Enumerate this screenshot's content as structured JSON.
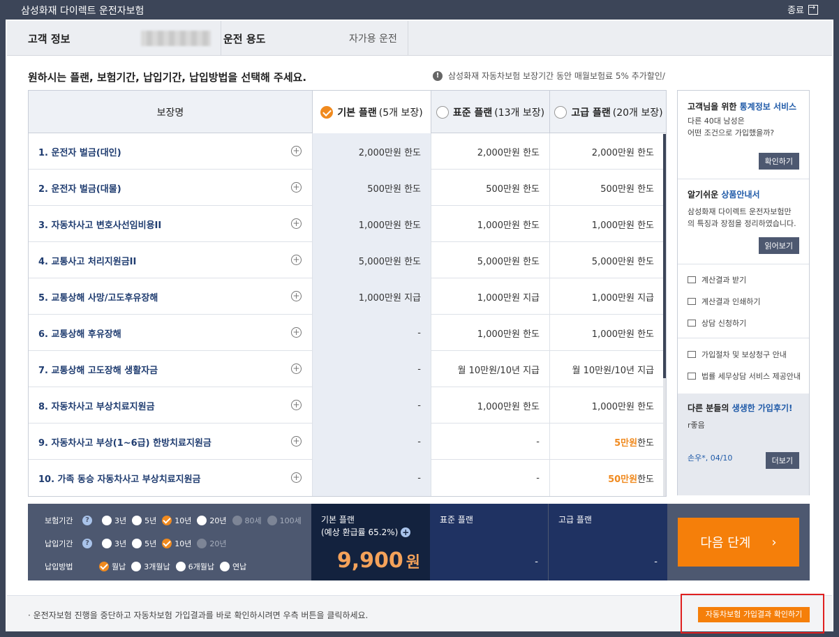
{
  "window": {
    "title": "삼성화재 다이렉트 운전자보험",
    "exit_label": "종료"
  },
  "info": {
    "customer_label": "고객 정보",
    "usage_label": "운전 용도",
    "usage_value": "자가용 운전"
  },
  "instruction": "원하시는 플랜, 보험기간, 납입기간, 납입방법을 선택해 주세요.",
  "notice": "삼성화재 자동차보험 보장기간 동안 매월보험료 5% 추가할인/",
  "table": {
    "col_name": "보장명",
    "plans": [
      {
        "name": "기본 플랜",
        "count": "(5개 보장)",
        "selected": true
      },
      {
        "name": "표준 플랜",
        "count": "(13개 보장)",
        "selected": false
      },
      {
        "name": "고급 플랜",
        "count": "(20개 보장)",
        "selected": false
      }
    ],
    "rows": [
      {
        "name": "1. 운전자 벌금(대인)",
        "basic": "2,000만원 한도",
        "std": "2,000만원 한도",
        "adv": "2,000만원 한도"
      },
      {
        "name": "2. 운전자 벌금(대물)",
        "basic": "500만원 한도",
        "std": "500만원 한도",
        "adv": "500만원 한도"
      },
      {
        "name": "3. 자동차사고 변호사선임비용II",
        "basic": "1,000만원 한도",
        "std": "1,000만원 한도",
        "adv": "1,000만원 한도"
      },
      {
        "name": "4. 교통사고 처리지원금II",
        "basic": "5,000만원 한도",
        "std": "5,000만원 한도",
        "adv": "5,000만원 한도"
      },
      {
        "name": "5. 교통상해 사망/고도후유장해",
        "basic": "1,000만원 지급",
        "std": "1,000만원 지급",
        "adv": "1,000만원 지급"
      },
      {
        "name": "6. 교통상해 후유장해",
        "basic": "-",
        "std": "1,000만원 한도",
        "adv": "1,000만원 한도"
      },
      {
        "name": "7. 교통상해 고도장해 생활자금",
        "basic": "-",
        "std": "월 10만원/10년 지급",
        "adv": "월 10만원/10년 지급"
      },
      {
        "name": "8. 자동차사고 부상치료지원금",
        "basic": "-",
        "std": "1,000만원 한도",
        "adv": "1,000만원 한도"
      },
      {
        "name": "9. 자동차사고 부상(1~6급) 한방치료지원금",
        "basic": "-",
        "std": "-",
        "adv_hl": "5만원",
        "adv_rest": " 한도"
      },
      {
        "name": "10. 가족 동승 자동차사고 부상치료지원금",
        "basic": "-",
        "std": "-",
        "adv_hl": "50만원",
        "adv_rest": " 한도"
      }
    ]
  },
  "side": {
    "stats": {
      "head_a": "고객님을 위한 ",
      "head_b": "통계정보 서비스",
      "text1": "다른 40대 남성은",
      "text2": "어떤 조건으로 가입했을까?",
      "btn": "확인하기"
    },
    "product": {
      "head_a": "알기쉬운 ",
      "head_b": "상품안내서",
      "text1": "삼성화재 다이렉트 운전자보험만",
      "text2": "의 특징과 장점을 정리하였습니다.",
      "btn": "읽어보기"
    },
    "links": [
      "계산결과 받기",
      "계산결과 인쇄하기",
      "상담 신청하기",
      "가입절차 및 보상청구 안내",
      "법률 세무상담 서비스 제공안내"
    ],
    "review": {
      "head_a": "다른 분들의 ",
      "head_b": "생생한 가입후기!",
      "text": "r좋음",
      "author": "손우*, 04/10",
      "btn": "더보기"
    }
  },
  "options": {
    "period_label": "보험기간",
    "period": [
      {
        "label": "3년",
        "state": "off"
      },
      {
        "label": "5년",
        "state": "off"
      },
      {
        "label": "10년",
        "state": "on"
      },
      {
        "label": "20년",
        "state": "off"
      },
      {
        "label": "80세",
        "state": "dis"
      },
      {
        "label": "100세",
        "state": "dis"
      }
    ],
    "pay_period_label": "납입기간",
    "pay_period": [
      {
        "label": "3년",
        "state": "off"
      },
      {
        "label": "5년",
        "state": "off"
      },
      {
        "label": "10년",
        "state": "on"
      },
      {
        "label": "20년",
        "state": "dis"
      }
    ],
    "method_label": "납입방법",
    "method": [
      {
        "label": "월납",
        "state": "on"
      },
      {
        "label": "3개월납",
        "state": "off"
      },
      {
        "label": "6개월납",
        "state": "off"
      },
      {
        "label": "연납",
        "state": "off"
      }
    ]
  },
  "summary": {
    "basic_name": "기본 플랜",
    "basic_refund": "(예상 환급률 65.2%)",
    "basic_price": "9,900",
    "currency": "원",
    "std_name": "표준 플랜",
    "std_price": "-",
    "adv_name": "고급 플랜",
    "adv_price": "-"
  },
  "next_button": "다음 단계",
  "next_arrow": "›",
  "footer": {
    "text": "· 운전자보험 진행을 중단하고 자동차보험 가입결과를 바로 확인하시려면 우측 버튼을 클릭하세요.",
    "button": "자동차보험 가입결과 확인하기"
  },
  "colors": {
    "accent": "#f57f0a",
    "navy": "#3c4558",
    "dark": "#13223e"
  }
}
